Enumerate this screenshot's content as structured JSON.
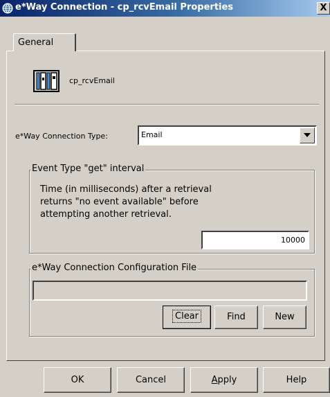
{
  "window": {
    "title": "e*Way Connection - cp_rcvEmail Properties",
    "close_symbol": "X",
    "title_icon": "globe-icon"
  },
  "tabs": [
    {
      "label": "General",
      "selected": true
    }
  ],
  "component": {
    "icon": "connection-point-icon",
    "name": "cp_rcvEmail"
  },
  "connection_type": {
    "label": "e*Way Connection Type:",
    "value": "Email"
  },
  "event_interval": {
    "group_title": "Event Type \"get\" interval",
    "description_lines": [
      "Time (in milliseconds) after a retrieval",
      "returns \"no event available\" before",
      "attempting another retrieval."
    ],
    "value": "10000"
  },
  "config_file": {
    "group_title": "e*Way Connection Configuration File",
    "value": "",
    "buttons": {
      "clear": "Clear",
      "find": "Find",
      "new": "New"
    }
  },
  "dialog_buttons": {
    "ok": "OK",
    "cancel": "Cancel",
    "apply_pre": "",
    "apply_mnemonic": "A",
    "apply_post": "pply",
    "help": "Help"
  },
  "colors": {
    "face": "#d4d0c8",
    "title_start": "#0a246a",
    "title_end": "#a6caf0"
  }
}
